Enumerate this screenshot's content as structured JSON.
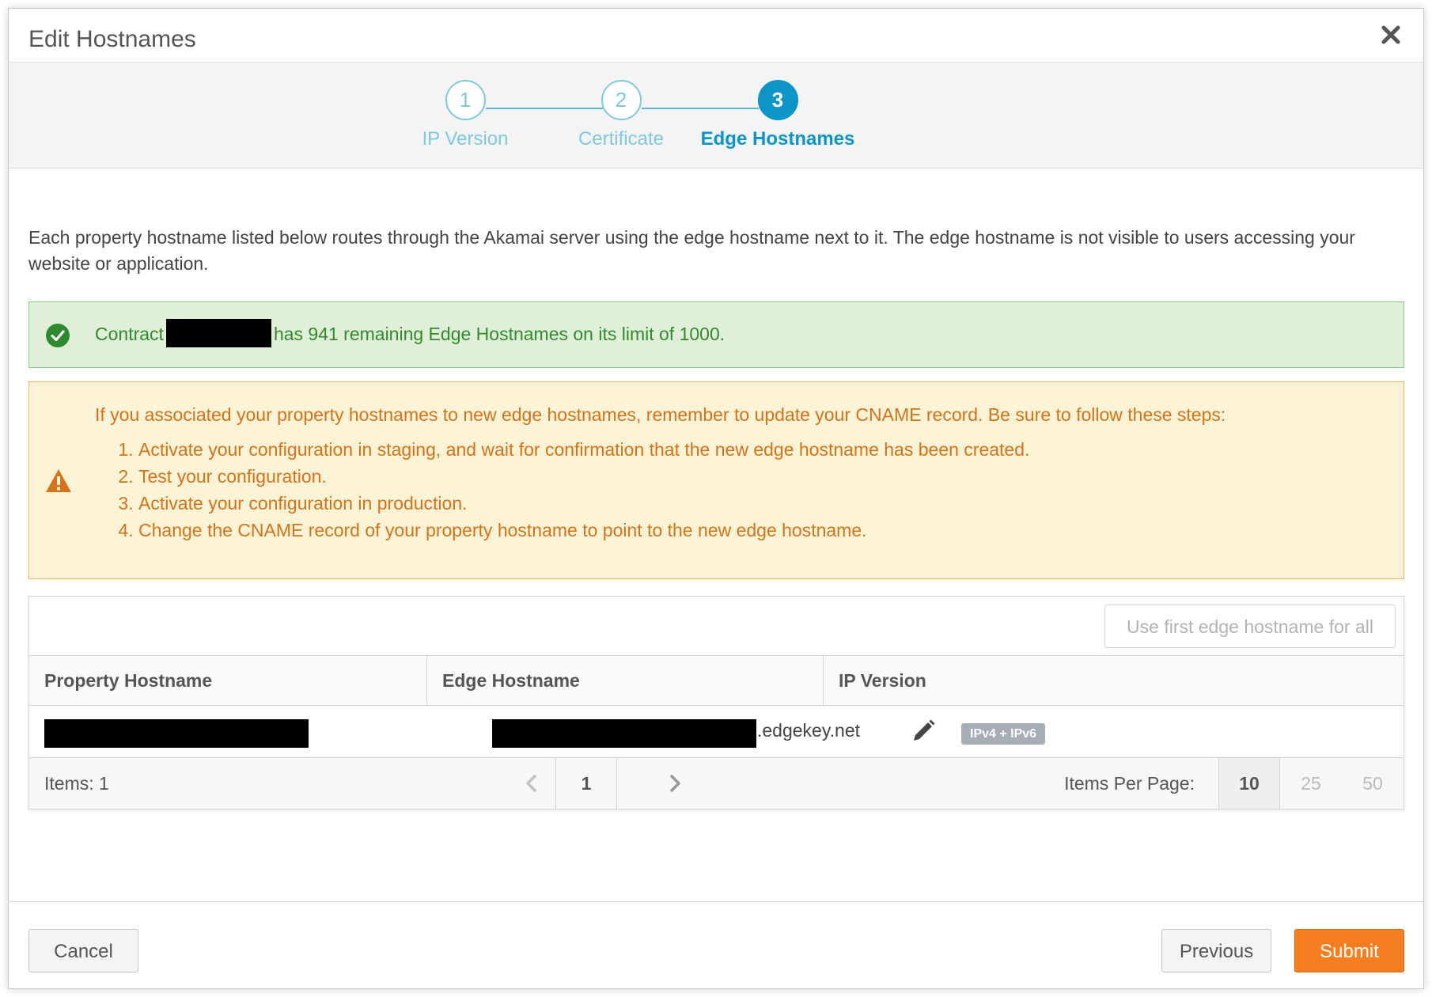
{
  "dialog": {
    "title": "Edit Hostnames"
  },
  "stepper": {
    "steps": [
      {
        "number": "1",
        "label": "IP Version"
      },
      {
        "number": "2",
        "label": "Certificate"
      },
      {
        "number": "3",
        "label": "Edge Hostnames"
      }
    ],
    "active_step": 3
  },
  "intro_text": "Each property hostname listed below routes through the Akamai server using the edge hostname next to it. The edge hostname is not visible to users accessing your website or application.",
  "success_alert": {
    "prefix": "Contract",
    "suffix": "has 941 remaining Edge Hostnames on its limit of 1000."
  },
  "warning_alert": {
    "message": "If you associated your property hostnames to new edge hostnames, remember to update your CNAME record. Be sure to follow these steps:",
    "steps": [
      "Activate your configuration in staging, and wait for confirmation that the new edge hostname has been created.",
      "Test your configuration.",
      "Activate your configuration in production.",
      "Change the CNAME record of your property hostname to point to the new edge hostname."
    ]
  },
  "table": {
    "use_first_button": "Use first edge hostname for all",
    "columns": [
      "Property Hostname",
      "Edge Hostname",
      "IP Version"
    ],
    "rows": [
      {
        "edge_suffix": ".edgekey.net",
        "ip_version": "IPv4 + IPv6"
      }
    ],
    "footer": {
      "items_label": "Items: 1",
      "current_page": "1",
      "per_page_label": "Items Per Page:",
      "per_page_options": [
        "10",
        "25",
        "50"
      ],
      "per_page_selected": "10"
    }
  },
  "footer_buttons": {
    "cancel": "Cancel",
    "previous": "Previous",
    "submit": "Submit"
  },
  "colors": {
    "accent": "#0d95c8",
    "step_inactive": "#7fc9df",
    "success_text": "#338a2e",
    "warning_text": "#d4731a",
    "submit": "#f47e20"
  }
}
